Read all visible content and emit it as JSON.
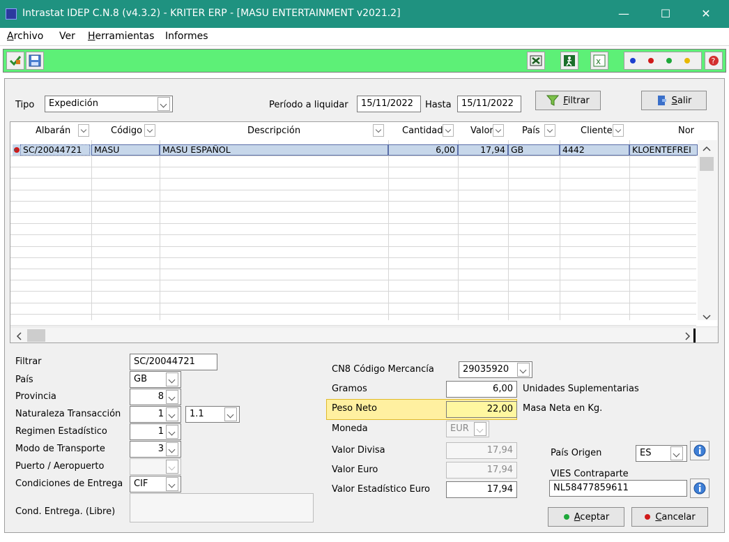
{
  "window": {
    "title": "Intrastat IDEP C.N.8 (v4.3.2) - KRITER ERP - [MASU ENTERTAINMENT v2021.2]",
    "minimize_glyph": "—",
    "maximize_glyph": "☐",
    "close_glyph": "✕"
  },
  "menu": {
    "items": [
      {
        "label": "Archivo",
        "first": "A",
        "rest": "rchivo"
      },
      {
        "label": "Ver",
        "first": "",
        "rest": "Ver"
      },
      {
        "label": "Herramientas",
        "first": "H",
        "rest": "erramientas"
      },
      {
        "label": "Informes",
        "first": "",
        "rest": "Informes"
      }
    ]
  },
  "toolbar": {
    "left_icons": [
      "check-pencil-icon",
      "save-disk-icon"
    ],
    "right_icons": [
      "excel-x-icon",
      "exit-person-icon",
      "excel-export-icon",
      "color-dots-icon",
      "help-icon"
    ],
    "dot_colors": [
      "#1c3fcf",
      "#d01a1a",
      "#1ea83a",
      "#e8b800"
    ]
  },
  "filter_bar": {
    "tipo_label": "Tipo",
    "tipo_value": "Expedición",
    "periodo_label": "Período a liquidar",
    "periodo_from": "15/11/2022",
    "hasta_label": "Hasta",
    "periodo_to": "15/11/2022",
    "filtrar_first": "F",
    "filtrar_rest": "iltrar",
    "salir_first": "S",
    "salir_rest": "alir"
  },
  "grid": {
    "columns": [
      "Albarán",
      "Código",
      "Descripción",
      "Cantidad",
      "Valor",
      "País",
      "Cliente",
      "Nor"
    ],
    "rows": [
      {
        "albaran": "SC/20044721",
        "codigo": "MASU",
        "descripcion": "MASU ESPAÑOL",
        "cantidad": "6,00",
        "valor": "17,94",
        "pais": "GB",
        "cliente": "4442",
        "nombre": "KLOENTEFREI"
      }
    ]
  },
  "form": {
    "filtrar_label": "Filtrar",
    "filtrar_value": "SC/20044721",
    "pais_label": "País",
    "pais_value": "GB",
    "provincia_label": "Provincia",
    "provincia_value": "8",
    "naturaleza_label": "Naturaleza Transacción",
    "naturaleza_value": "1",
    "naturaleza_value2": "1.1",
    "regimen_label": "Regimen Estadístico",
    "regimen_value": "1",
    "modo_label": "Modo de Transporte",
    "modo_value": "3",
    "puerto_label": "Puerto / Aeropuerto",
    "condiciones_label": "Condiciones de Entrega",
    "condiciones_value": "CIF",
    "cond_libre_label": "Cond. Entrega. (Libre)",
    "cn8_label": "CN8 Código Mercancía",
    "cn8_value": "29035920",
    "gramos_label": "Gramos",
    "gramos_value": "6,00",
    "unidades_label": "Unidades Suplementarias",
    "peso_label": "Peso Neto",
    "peso_value": "22,00",
    "masa_label": "Masa Neta en Kg.",
    "moneda_label": "Moneda",
    "moneda_value": "EUR",
    "valor_divisa_label": "Valor Divisa",
    "valor_divisa_value": "17,94",
    "valor_euro_label": "Valor Euro",
    "valor_euro_value": "17,94",
    "valor_est_label": "Valor Estadístico Euro",
    "valor_est_value": "17,94",
    "pais_origen_label": "País Origen",
    "pais_origen_value": "ES",
    "vies_label": "VIES Contraparte",
    "vies_value": "NL58477859611",
    "aceptar_first": "A",
    "aceptar_rest": "ceptar",
    "cancelar_first": "C",
    "cancelar_rest": "ancelar"
  },
  "colors": {
    "titlebar": "#1f9280",
    "toolbar": "#5df077",
    "highlight": "#fff0a0",
    "selected_row": "#c7d7ea"
  }
}
